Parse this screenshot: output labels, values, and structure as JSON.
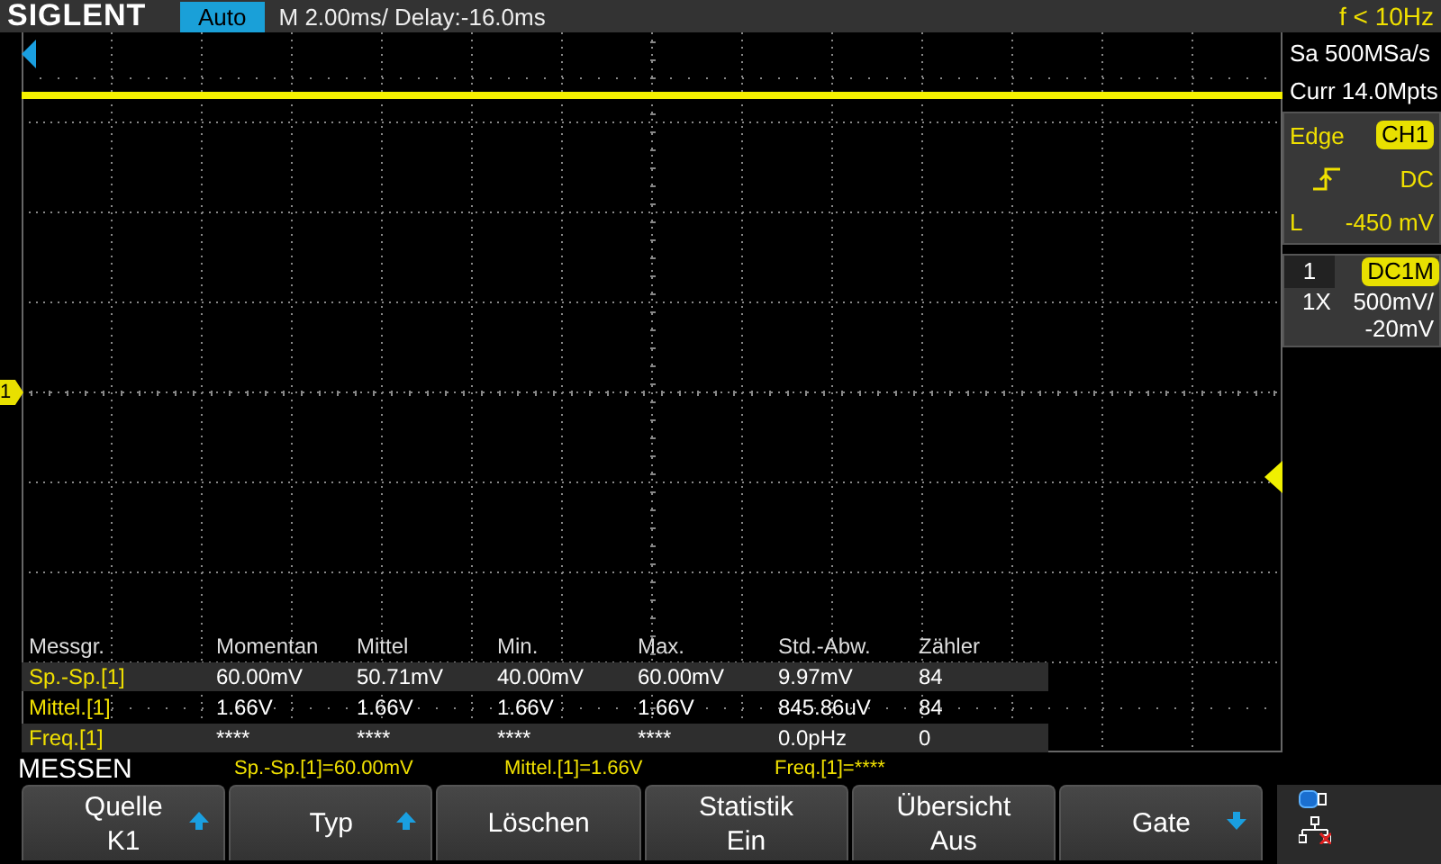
{
  "header": {
    "logo": "SIGLENT",
    "mode": "Auto",
    "timebase": "M 2.00ms/ Delay:-16.0ms",
    "trigger_frequency": "f < 10Hz"
  },
  "acquisition": {
    "sample_rate": "Sa 500MSa/s",
    "memory_depth": "Curr 14.0Mpts"
  },
  "trigger": {
    "type": "Edge",
    "source": "CH1",
    "coupling": "DC",
    "level_label": "L",
    "level_value": "-450 mV"
  },
  "channel": {
    "number": "1",
    "coupling": "DC1M",
    "probe": "1X",
    "scale": "500mV/",
    "offset": "-20mV"
  },
  "channel_marker": "1",
  "measurements": {
    "columns": [
      "Messgr.",
      "Momentan",
      "Mittel",
      "Min.",
      "Max.",
      "Std.-Abw.",
      "Zähler"
    ],
    "rows": [
      {
        "name": "Sp.-Sp.[1]",
        "values": [
          "60.00mV",
          "50.71mV",
          "40.00mV",
          "60.00mV",
          "9.97mV",
          "84"
        ]
      },
      {
        "name": "Mittel.[1]",
        "values": [
          "1.66V",
          "1.66V",
          "1.66V",
          "1.66V",
          "845.86uV",
          "84"
        ]
      },
      {
        "name": "Freq.[1]",
        "values": [
          "****",
          "****",
          "****",
          "****",
          "0.0pHz",
          "0"
        ]
      }
    ]
  },
  "status": {
    "title": "MESSEN",
    "readouts": [
      "Sp.-Sp.[1]=60.00mV",
      "Mittel.[1]=1.66V",
      "Freq.[1]=****"
    ]
  },
  "softkeys": [
    {
      "label": "Quelle",
      "value": "K1",
      "kind": "up"
    },
    {
      "label": "Typ",
      "kind": "up"
    },
    {
      "label": "Löschen"
    },
    {
      "label": "Statistik",
      "value": "Ein"
    },
    {
      "label": "Übersicht",
      "value": "Aus"
    },
    {
      "label": "Gate",
      "kind": "down"
    }
  ]
}
